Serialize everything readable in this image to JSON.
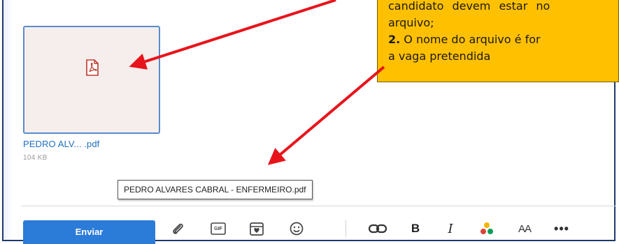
{
  "attachment": {
    "file_name": "PEDRO ALV... .pdf",
    "file_size": "104 KB",
    "tooltip": "PEDRO ALVARES CABRAL - ENFERMEIRO.pdf",
    "icon": "pdf-file-icon"
  },
  "toolbar": {
    "send_label": "Enviar",
    "attach_icon": "paperclip-icon",
    "gif_label": "GIF",
    "bold_label": "B",
    "italic_label": "I",
    "size_label": "AA",
    "more_label": "•••"
  },
  "callout": {
    "line1": "candidato devem estar no",
    "line2": "arquivo;",
    "line3_num": "2.",
    "line3_text": " O nome do arquivo é for",
    "line4": "a vaga pretendida"
  },
  "colors": {
    "accent": "#2b7bd8",
    "callout_bg": "#ffc000",
    "arrow": "#e8141b"
  }
}
